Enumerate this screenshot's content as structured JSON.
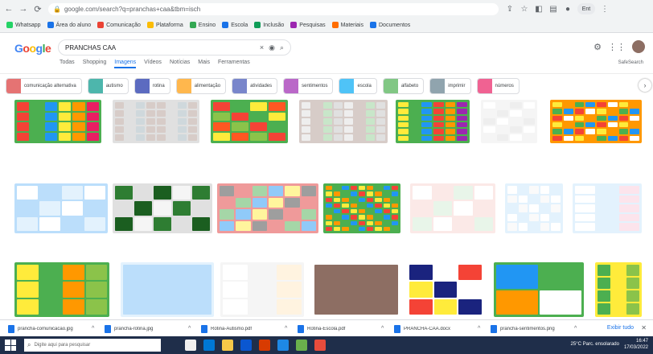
{
  "browser": {
    "url": "google.com/search?q=pranchas+caa&tbm=isch",
    "profile_label": "Ent"
  },
  "bookmarks": [
    {
      "label": "Whatsapp",
      "color": "#25d366"
    },
    {
      "label": "Área do aluno",
      "color": "#1a73e8"
    },
    {
      "label": "Comunicação",
      "color": "#ea4335"
    },
    {
      "label": "Plataforma",
      "color": "#fbbc05"
    },
    {
      "label": "Ensino",
      "color": "#34a853"
    },
    {
      "label": "Escola",
      "color": "#1a73e8"
    },
    {
      "label": "Inclusão",
      "color": "#0f9d58"
    },
    {
      "label": "Pesquisas",
      "color": "#9c27b0"
    },
    {
      "label": "Materiais",
      "color": "#ff6d00"
    },
    {
      "label": "Documentos",
      "color": "#1a73e8"
    }
  ],
  "google": {
    "logo": "Google",
    "query": "PRANCHAS CAA",
    "tabs": [
      {
        "label": "Todas",
        "active": false
      },
      {
        "label": "Shopping",
        "active": false
      },
      {
        "label": "Imagens",
        "active": true
      },
      {
        "label": "Vídeos",
        "active": false
      },
      {
        "label": "Notícias",
        "active": false
      },
      {
        "label": "Mais",
        "active": false
      },
      {
        "label": "Ferramentas",
        "active": false
      }
    ],
    "safesearch": "SafeSearch"
  },
  "chips": [
    {
      "label": "comunicação alternativa",
      "color": "#e57373"
    },
    {
      "label": "autismo",
      "color": "#4db6ac"
    },
    {
      "label": "rotina",
      "color": "#5c6bc0"
    },
    {
      "label": "alimentação",
      "color": "#ffb74d"
    },
    {
      "label": "atividades",
      "color": "#7986cb"
    },
    {
      "label": "sentimentos",
      "color": "#ba68c8"
    },
    {
      "label": "escola",
      "color": "#4fc3f7"
    },
    {
      "label": "alfabeto",
      "color": "#81c784"
    },
    {
      "label": "imprimir",
      "color": "#90a4ae"
    },
    {
      "label": "números",
      "color": "#f06292"
    }
  ],
  "grid": [
    {
      "caption": "",
      "source": "",
      "palette": [
        "#f44336",
        "#4caf50",
        "#2196f3",
        "#ffeb3b",
        "#ff9800",
        "#e91e63"
      ],
      "cols": 6,
      "rows": 4
    },
    {
      "caption": "",
      "source": "",
      "palette": [
        "#d7ccc8",
        "#e0e0e0",
        "#cfd8dc",
        "#d7ccc8"
      ],
      "cols": 8,
      "rows": 5
    },
    {
      "caption": "",
      "source": "",
      "palette": [
        "#f44336",
        "#4caf50",
        "#ffeb3b",
        "#ff5722",
        "#8bc34a"
      ],
      "cols": 4,
      "rows": 4
    },
    {
      "caption": "",
      "source": "",
      "palette": [
        "#eeeeee",
        "#d7ccc8",
        "#c8e6c9",
        "#e0e0e0"
      ],
      "cols": 8,
      "rows": 5
    },
    {
      "caption": "",
      "source": "",
      "palette": [
        "#ffeb3b",
        "#4caf50",
        "#2196f3",
        "#f44336",
        "#ff9800",
        "#9c27b0"
      ],
      "cols": 6,
      "rows": 6
    },
    {
      "caption": "",
      "source": "",
      "palette": [
        "#ffffff",
        "#f5f5f5",
        "#eeeeee"
      ],
      "cols": 4,
      "rows": 5
    },
    {
      "caption": "",
      "source": "",
      "palette": [
        "#ffeb3b",
        "#ff9800",
        "#4caf50",
        "#2196f3",
        "#f44336",
        "#ffffff"
      ],
      "cols": 8,
      "rows": 6
    },
    {
      "caption": "",
      "source": "",
      "palette": [
        "#ffffff",
        "#bbdefb",
        "#e3f2fd"
      ],
      "cols": 4,
      "rows": 3
    },
    {
      "caption": "",
      "source": "",
      "palette": [
        "#2e7d32",
        "#e0e0e0",
        "#1b5e20",
        "#f5f5f5"
      ],
      "cols": 5,
      "rows": 3
    },
    {
      "caption": "",
      "source": "",
      "palette": [
        "#9e9e9e",
        "#ef9a9a",
        "#a5d6a7",
        "#90caf9",
        "#fff59d"
      ],
      "cols": 6,
      "rows": 4
    },
    {
      "caption": "",
      "source": "",
      "palette": [
        "#ff9800",
        "#4caf50",
        "#2196f3",
        "#f44336",
        "#ffeb3b"
      ],
      "cols": 9,
      "rows": 8
    },
    {
      "caption": "",
      "source": "",
      "palette": [
        "#ffffff",
        "#fbe9e7",
        "#e8f5e9"
      ],
      "cols": 4,
      "rows": 3
    },
    {
      "caption": "",
      "source": "",
      "palette": [
        "#ffffff",
        "#e3f2fd",
        "#fafafa"
      ],
      "cols": 5,
      "rows": 5
    },
    {
      "caption": "",
      "source": "",
      "palette": [
        "#ffffff",
        "#e3f2fd",
        "#fce4ec"
      ],
      "cols": 3,
      "rows": 5
    },
    {
      "caption": "",
      "source": "",
      "palette": [
        "#ffeb3b",
        "#4caf50",
        "#ff9800",
        "#8bc34a"
      ],
      "cols": 4,
      "rows": 3
    },
    {
      "caption": "",
      "source": "",
      "palette": [
        "#bbdefb",
        "#e3f2fd",
        "#ffe0b2"
      ],
      "cols": 1,
      "rows": 1
    },
    {
      "caption": "",
      "source": "",
      "palette": [
        "#ffffff",
        "#f5f5f5",
        "#fff3e0"
      ],
      "cols": 3,
      "rows": 3
    },
    {
      "caption": "",
      "source": "",
      "palette": [
        "#8d6e63",
        "#ffffff",
        "#d7ccc8"
      ],
      "cols": 1,
      "rows": 1
    },
    {
      "caption": "",
      "source": "",
      "palette": [
        "#1a237e",
        "#ffffff",
        "#f44336",
        "#ffeb3b"
      ],
      "cols": 3,
      "rows": 3
    },
    {
      "caption": "",
      "source": "",
      "palette": [
        "#2196f3",
        "#4caf50",
        "#ff9800",
        "#ffffff"
      ],
      "cols": 2,
      "rows": 2
    },
    {
      "caption": "",
      "source": "",
      "palette": [
        "#4caf50",
        "#ffeb3b",
        "#8bc34a"
      ],
      "cols": 3,
      "rows": 4
    }
  ],
  "downloads": [
    {
      "name": "prancha-comunicacao.jpg"
    },
    {
      "name": "prancha-rotina.jpg"
    },
    {
      "name": "Rotina-Autismo.pdf"
    },
    {
      "name": "Rotina-Escola.pdf"
    },
    {
      "name": "PRANCHA-CAA.docx"
    },
    {
      "name": "prancha-sentimentos.png"
    }
  ],
  "downloads_showall": "Exibir tudo",
  "taskbar": {
    "search_placeholder": "Digite aqui para pesquisar",
    "weather": "25°C Parc. ensolarado",
    "time": "16:47",
    "date": "17/03/2022",
    "apps": [
      "#f0f0f0",
      "#0078d4",
      "#f7c948",
      "#0b57d0",
      "#d83b01",
      "#1e88e5",
      "#6ab04c",
      "#e74c3c"
    ]
  }
}
